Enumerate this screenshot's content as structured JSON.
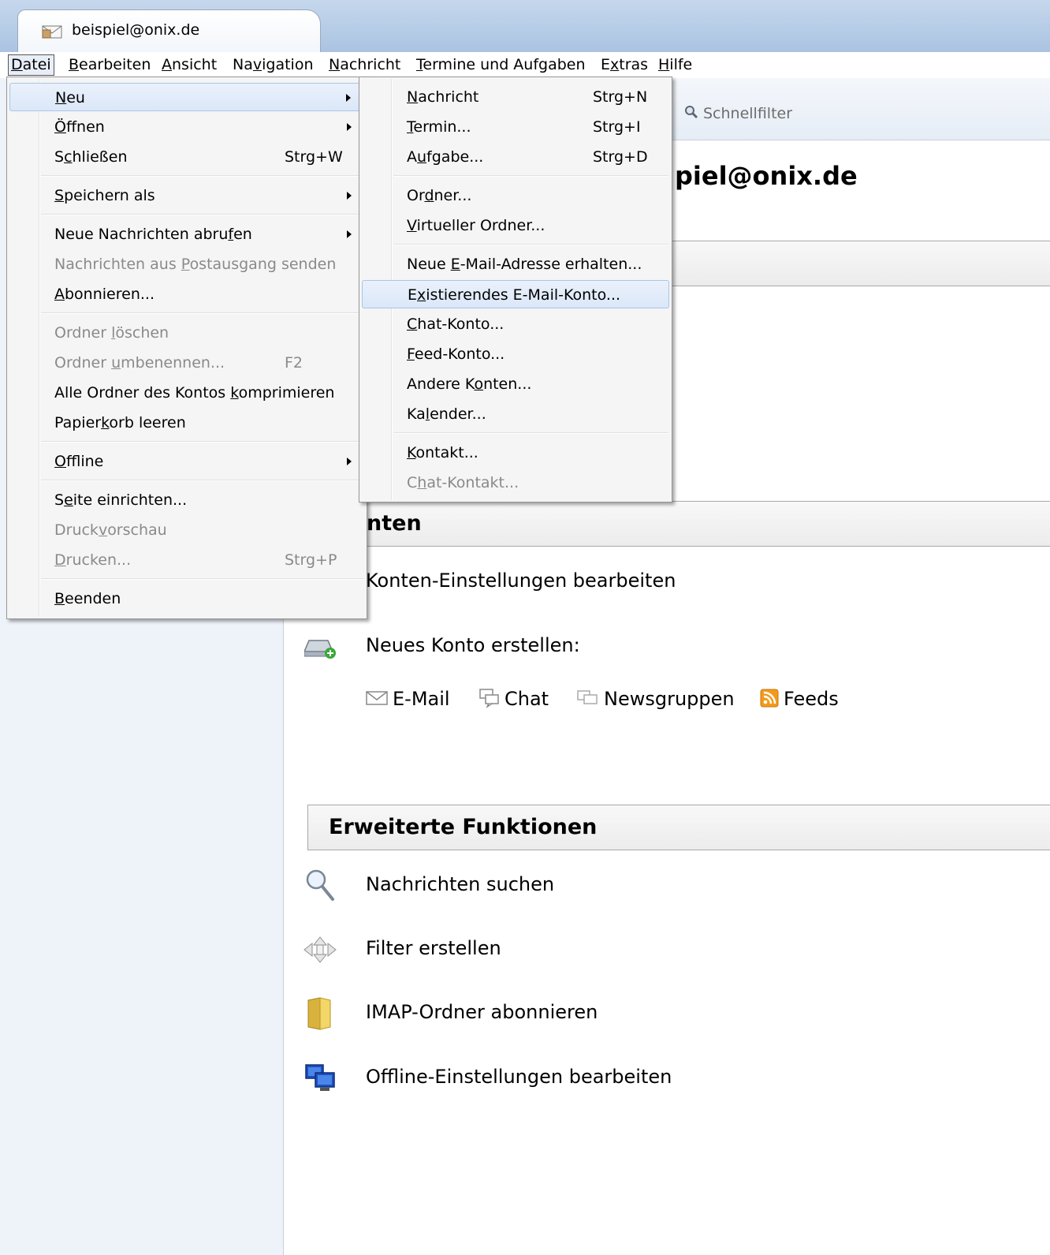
{
  "tab": {
    "title": "beispiel@onix.de",
    "icon": "mail-account-icon"
  },
  "menubar": {
    "items": [
      {
        "label": "Datei",
        "mnemonic_pre": "",
        "mnemonic": "D",
        "mnemonic_post": "atei"
      },
      {
        "label": "Bearbeiten"
      },
      {
        "label": "Ansicht"
      },
      {
        "label": "Navigation"
      },
      {
        "label": "Nachricht"
      },
      {
        "label": "Termine und Aufgaben"
      },
      {
        "label": "Extras"
      },
      {
        "label": "Hilfe"
      }
    ]
  },
  "toolbar": {
    "quickfilter": "Schnellfilter"
  },
  "account": {
    "title_visible": "piel@onix.de"
  },
  "sections": {
    "konten_visible": "nten",
    "erweiterte": "Erweiterte Funktionen"
  },
  "konten": {
    "edit_settings": "Konten-Einstellungen bearbeiten",
    "new_account": "Neues Konto erstellen:",
    "types": [
      "E-Mail",
      "Chat",
      "Newsgruppen",
      "Feeds"
    ]
  },
  "advanced": {
    "search": "Nachrichten suchen",
    "filter": "Filter erstellen",
    "imap": "IMAP-Ordner abonnieren",
    "offline": "Offline-Einstellungen bearbeiten"
  },
  "datei_menu": {
    "neu": "Neu",
    "oeffnen": "Öffnen",
    "schliessen": "Schließen",
    "schliessen_sc": "Strg+W",
    "speichern": "Speichern als",
    "abrufen": "Neue Nachrichten abrufen",
    "postausgang": "Nachrichten aus Postausgang senden",
    "abonnieren": "Abonnieren...",
    "ordner_loeschen": "Ordner löschen",
    "ordner_umbenennen": "Ordner umbenennen...",
    "ordner_umbenennen_sc": "F2",
    "komprimieren": "Alle Ordner des Kontos komprimieren",
    "papierkorb": "Papierkorb leeren",
    "offline": "Offline",
    "seite": "Seite einrichten...",
    "druckvorschau": "Druckvorschau",
    "drucken": "Drucken...",
    "drucken_sc": "Strg+P",
    "beenden": "Beenden"
  },
  "neu_menu": {
    "nachricht": "Nachricht",
    "nachricht_sc": "Strg+N",
    "termin": "Termin...",
    "termin_sc": "Strg+I",
    "aufgabe": "Aufgabe...",
    "aufgabe_sc": "Strg+D",
    "ordner": "Ordner...",
    "virtueller": "Virtueller Ordner...",
    "neue_email": "Neue E-Mail-Adresse erhalten...",
    "existierend": "Existierendes E-Mail-Konto...",
    "chat_konto": "Chat-Konto...",
    "feed_konto": "Feed-Konto...",
    "andere": "Andere Konten...",
    "kalender": "Kalender...",
    "kontakt": "Kontakt...",
    "chat_kontakt": "Chat-Kontakt..."
  }
}
